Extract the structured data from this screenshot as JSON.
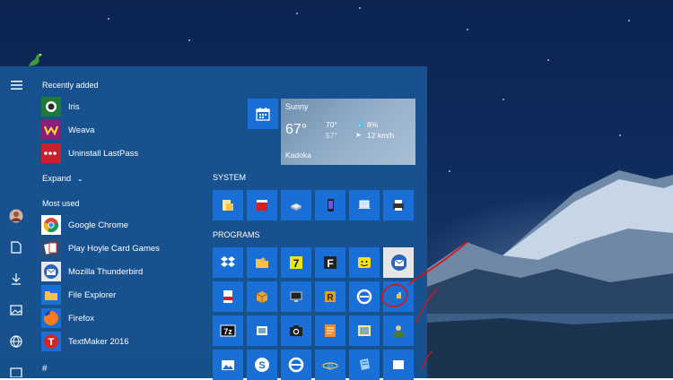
{
  "recently_added": {
    "heading": "Recently added",
    "items": [
      {
        "label": "Iris",
        "icon": "iris-icon",
        "bg": "#1e7a3a"
      },
      {
        "label": "Weava",
        "icon": "weava-icon",
        "bg": "#8a1f7a"
      },
      {
        "label": "Uninstall LastPass",
        "icon": "lastpass-icon",
        "bg": "#c8202e"
      }
    ],
    "expand_label": "Expand"
  },
  "most_used": {
    "heading": "Most used",
    "items": [
      {
        "label": "Google Chrome",
        "icon": "chrome-icon"
      },
      {
        "label": "Play Hoyle Card Games",
        "icon": "hoyle-icon"
      },
      {
        "label": "Mozilla Thunderbird",
        "icon": "thunderbird-icon"
      },
      {
        "label": "File Explorer",
        "icon": "folder-icon"
      },
      {
        "label": "Firefox",
        "icon": "firefox-icon"
      },
      {
        "label": "TextMaker 2016",
        "icon": "textmaker-icon"
      }
    ]
  },
  "hash_label": "#",
  "weather": {
    "condition": "Sunny",
    "temperature": "67°",
    "high": "70°",
    "low": "57°",
    "humidity": "8%",
    "wind": "12 km/h",
    "location": "Kadoka"
  },
  "groups": {
    "system_label": "SYSTEM",
    "programs_label": "PROGRAMS"
  },
  "colors": {
    "start_bg": "#1f5a96",
    "tile_blue": "#1a6fd6",
    "annotation_red": "#e01010"
  }
}
